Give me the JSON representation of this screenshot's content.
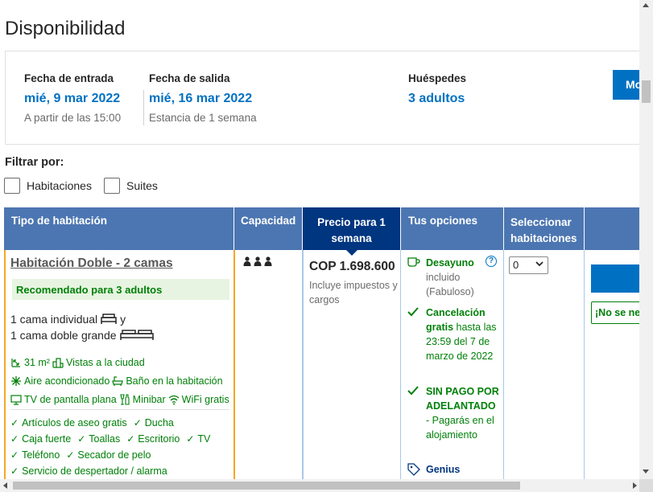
{
  "page": {
    "title": "Disponibilidad"
  },
  "booking": {
    "checkin": {
      "label": "Fecha de entrada",
      "date": "mié, 9 mar 2022",
      "note": "A partir de las 15:00"
    },
    "checkout": {
      "label": "Fecha de salida",
      "date": "mié, 16 mar 2022",
      "note": "Estancia de 1 semana"
    },
    "guests": {
      "label": "Huéspedes",
      "value": "3 adultos"
    },
    "modify_button": "Mo"
  },
  "filters": {
    "label": "Filtrar por:",
    "options": [
      {
        "label": "Habitaciones",
        "checked": false
      },
      {
        "label": "Suites",
        "checked": false
      }
    ]
  },
  "table": {
    "headers": {
      "room_type": "Tipo de habitación",
      "capacity": "Capacidad",
      "price": "Precio para 1 semana",
      "options": "Tus opciones",
      "select": "Seleccionar habitaciones"
    },
    "room": {
      "name": "Habitación Doble - 2 camas",
      "recommended": "Recomendado para 3 adultos",
      "beds": [
        "1 cama individual",
        "y",
        "1 cama doble grande"
      ],
      "size": "31 m²",
      "amenities": [
        "Vistas a la ciudad",
        "Aire acondicionado",
        "Baño en la habitación",
        "TV de pantalla plana",
        "Minibar",
        "WiFi gratis"
      ],
      "checks": [
        [
          "Artículos de aseo gratis",
          "Ducha"
        ],
        [
          "Caja fuerte",
          "Toallas",
          "Escritorio",
          "TV"
        ],
        [
          "Teléfono",
          "Secador de pelo"
        ],
        [
          "Servicio de despertador / alarma"
        ]
      ],
      "capacity_persons": 3,
      "price": "COP 1.698.600",
      "price_note": "Incluye impuestos y cargos",
      "options": {
        "breakfast_title": "Desayuno",
        "breakfast_text": "incluido (Fabuloso)",
        "cancel_title": "Cancelación gratis",
        "cancel_text": "hasta las 23:59 del 7 de marzo de 2022",
        "nopay_title": "SIN PAGO POR ADELANTADO",
        "nopay_text": "- Pagarás en el alojamiento",
        "genius": "Genius"
      },
      "select_value": "0",
      "no_need_text": "¡No se nec"
    }
  },
  "colors": {
    "header_blue": "#4c76b2",
    "header_dark": "#003580",
    "link_blue": "#0071c2",
    "green": "#008009",
    "highlight_orange": "#f5a623"
  }
}
